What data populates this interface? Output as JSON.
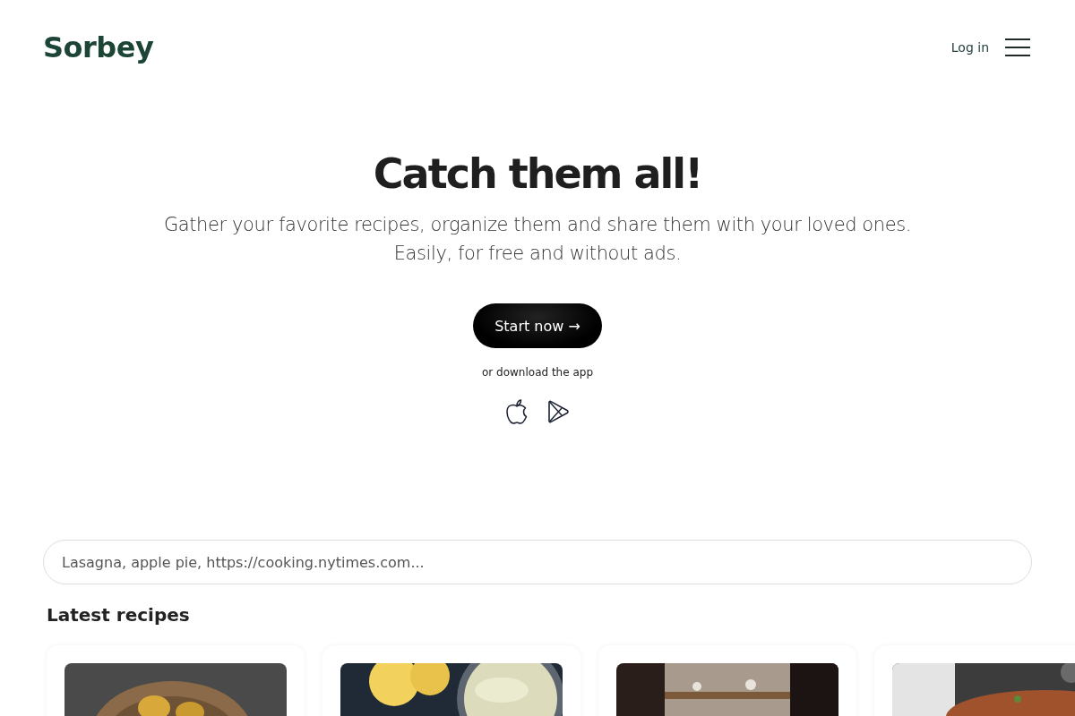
{
  "header": {
    "logo": "Sorbey",
    "login": "Log in"
  },
  "hero": {
    "title": "Catch them all!",
    "subtitle": "Gather your favorite recipes, organize them and share them with your loved ones. Easily, for free and without ads.",
    "cta": "Start now →",
    "download_text": "or download the app"
  },
  "search": {
    "placeholder": "Lasagna, apple pie, https://cooking.nytimes.com..."
  },
  "latest": {
    "title": "Latest recipes"
  }
}
